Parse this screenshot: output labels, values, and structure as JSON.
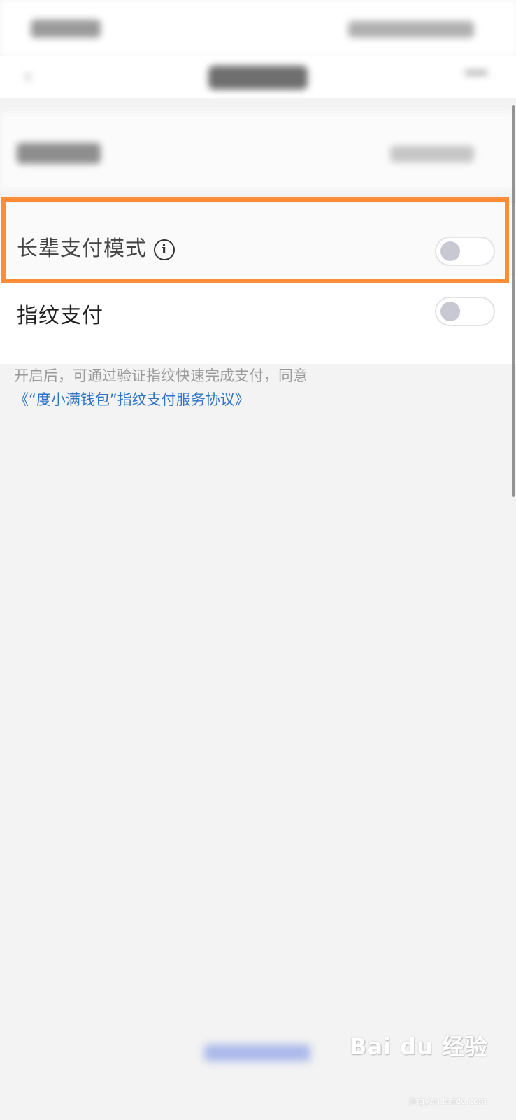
{
  "settings": {
    "elder_mode": {
      "label": "长辈支付模式",
      "enabled": false
    },
    "fingerprint": {
      "label": "指纹支付",
      "enabled": false
    },
    "hint_text": "开启后，可通过验证指纹快速完成支付，同意",
    "hint_link": "《“度小满钱包”指纹支付服务协议》"
  },
  "watermark": {
    "text": "Bai du 经验",
    "sub": "jingyan.baidu.com"
  },
  "colors": {
    "highlight": "#ff8c37",
    "link": "#2d74c9"
  },
  "icons": {
    "info": "info-circle-icon",
    "back": "chevron-left-icon",
    "more": "more-icon"
  }
}
